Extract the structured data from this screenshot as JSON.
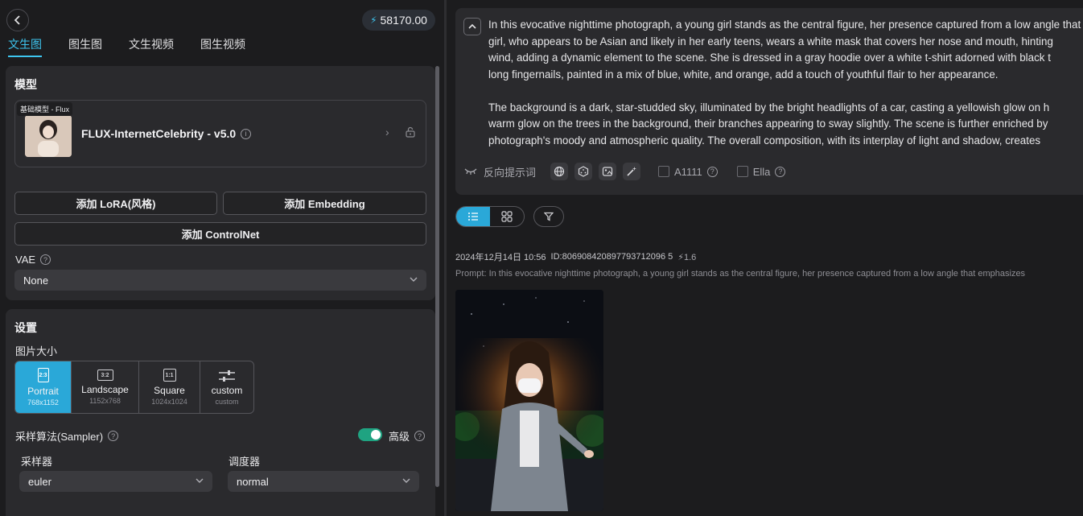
{
  "header": {
    "credits": "58170.00",
    "tabs": [
      "文生图",
      "图生图",
      "文生视频",
      "图生视频"
    ]
  },
  "model_section": {
    "title": "模型",
    "tag": "基础模型 - Flux",
    "model_name": "FLUX-InternetCelebrity - v5.0",
    "add_lora": "添加 LoRA(风格)",
    "add_embedding": "添加 Embedding",
    "add_controlnet": "添加 ControlNet",
    "vae_label": "VAE",
    "vae_value": "None"
  },
  "settings": {
    "title": "设置",
    "size_label": "图片大小",
    "ratios": [
      {
        "name": "Portrait",
        "sub": "768x1152",
        "icon": "2:3"
      },
      {
        "name": "Landscape",
        "sub": "1152x768",
        "icon": "3:2"
      },
      {
        "name": "Square",
        "sub": "1024x1024",
        "icon": "1:1"
      },
      {
        "name": "custom",
        "sub": "custom",
        "icon": "sliders"
      }
    ],
    "sampler_title": "采样算法(Sampler)",
    "advanced_label": "高级",
    "sampler_label": "采样器",
    "sampler_value": "euler",
    "scheduler_label": "调度器",
    "scheduler_value": "normal"
  },
  "prompt_panel": {
    "text": "In this evocative nighttime photograph, a young girl stands as the central figure, her presence captured from a low angle that emphasizes\ngirl, who appears to be Asian and likely in her early teens, wears a white mask that covers her nose and mouth, hinting\nwind, adding a dynamic element to the scene. She is dressed in a gray hoodie over a white t-shirt adorned with black t\nlong fingernails, painted in a mix of blue, white, and orange, add a touch of youthful flair to her appearance.\n\nThe background is a dark, star-studded sky, illuminated by the bright headlights of a car, casting a yellowish glow on h\nwarm glow on the trees in the background, their branches appearing to sway slightly. The scene is further enriched by\nphotograph's moody and atmospheric quality. The overall composition, with its interplay of light and shadow, creates",
    "negative_label": "反向提示词",
    "a1111_label": "A1111",
    "ella_label": "Ella"
  },
  "result": {
    "date": "2024年12月14日 10:56",
    "id": "ID:806908420897793712096 5",
    "cost": "1.6",
    "prompt_line": "Prompt: In this evocative nighttime photograph, a young girl stands as the central figure, her presence captured from a low angle that emphasizes"
  }
}
